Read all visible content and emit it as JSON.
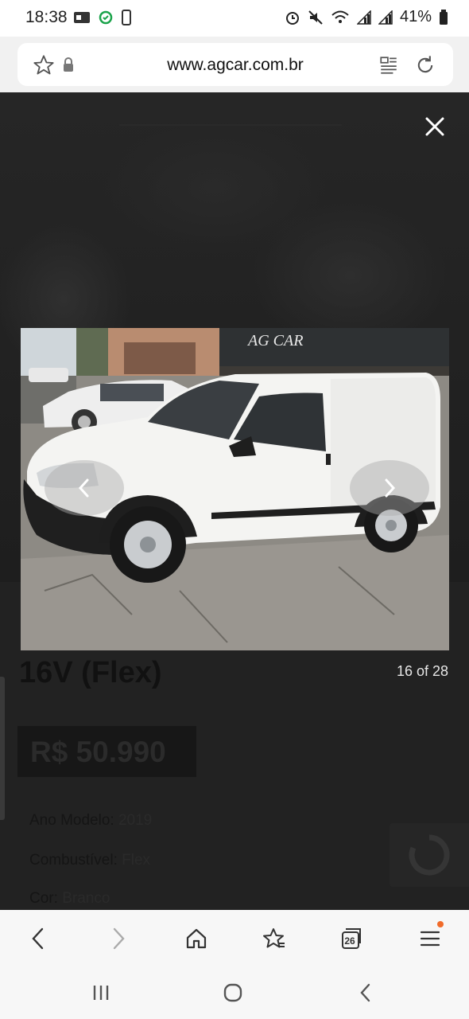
{
  "status_bar": {
    "time": "18:38",
    "battery": "41%",
    "icons": [
      "android-auto-icon",
      "sync-icon",
      "device-icon",
      "alarm-icon",
      "mute-icon",
      "wifi-icon",
      "signal-icon",
      "signal-icon",
      "battery-icon"
    ]
  },
  "browser": {
    "url": "www.agcar.com.br",
    "tab_count": "26",
    "icons": {
      "favorite": "star-icon",
      "secure": "lock-icon",
      "reader": "reader-mode-icon",
      "reload": "reload-icon"
    }
  },
  "page": {
    "title_fragment": "16V (Flex)",
    "price": "R$ 50.990",
    "specs": [
      {
        "label": "Ano Modelo:",
        "value": "2019"
      },
      {
        "label": "Combustível:",
        "value": "Flex"
      },
      {
        "label": "Cor:",
        "value": "Branco"
      }
    ]
  },
  "lightbox": {
    "counter": "16 of 28",
    "photo_description_icon": "van-photo",
    "close_icon": "close-icon",
    "prev_icon": "chevron-left-icon",
    "next_icon": "chevron-right-icon"
  },
  "colors": {
    "accent_dot": "#f16b2a",
    "overlay": "#222222"
  }
}
